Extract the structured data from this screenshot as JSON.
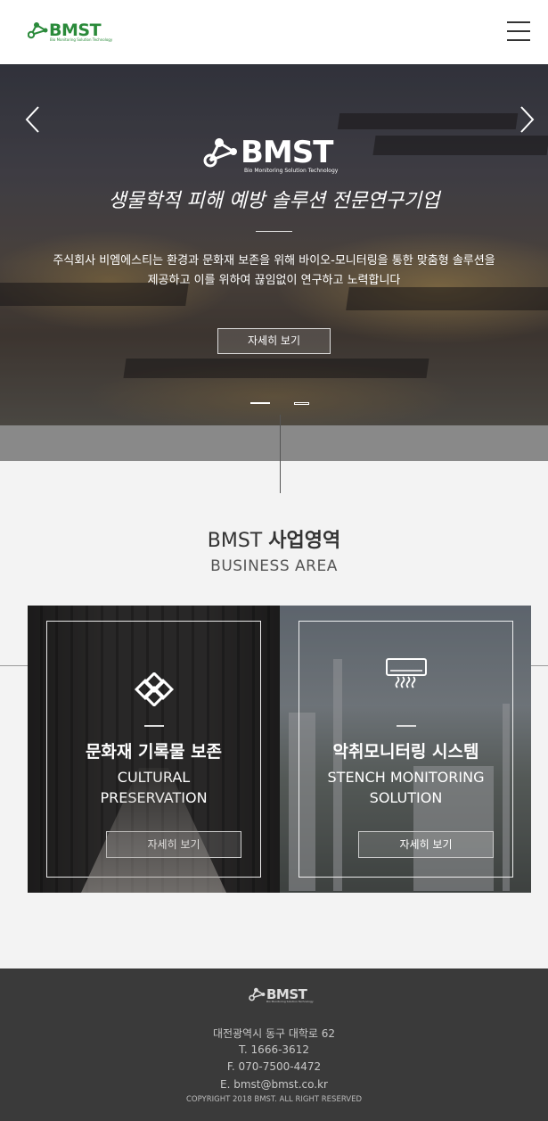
{
  "header": {
    "logo_text": "BMST",
    "logo_sub": "Bio Monitoring Solution Technology",
    "brand_color": "#2a8a3a",
    "menu_icon": "hamburger-menu-icon"
  },
  "hero": {
    "logo_text": "BMST",
    "logo_sub": "Bio Monitoring Solution Technology",
    "title": "생물학적 피해 예방 솔루션 전문연구기업",
    "desc_line1": "주식회사 비엠에스티는 환경과 문화재 보존을 위해 바이오-모니터링을 통한 맞춤형 솔루션을",
    "desc_line2": "제공하고 이를 위하여 끊임없이 연구하고 노력합니다",
    "button_label": "자세히 보기",
    "prev_icon": "chevron-left-icon",
    "next_icon": "chevron-right-icon",
    "slide_count": 2,
    "active_slide": 1
  },
  "business": {
    "title_prefix": "BMST",
    "title_main": "사업영역",
    "subtitle": "BUSINESS AREA",
    "cards": [
      {
        "icon": "knot-icon",
        "title": "문화재 기록물 보존",
        "en_line1": "CULTURAL",
        "en_line2": "PRESERVATION",
        "button_label": "자세히 보기"
      },
      {
        "icon": "odor-sensor-icon",
        "title": "악취모니터링 시스템",
        "en_line1": "STENCH MONITORING",
        "en_line2": "SOLUTION",
        "button_label": "자세히 보기"
      }
    ]
  },
  "footer": {
    "logo_text": "BMST",
    "logo_sub": "Bio Monitoring Solution Technology",
    "address": "대전광역시 동구 대학로 62",
    "tel": "T.  1666-3612",
    "fax": "F.  070-7500-4472",
    "email": "E.  bmst@bmst.co.kr",
    "copyright": "COPYRIGHT 2018 BMST. ALL RIGHT RESERVED"
  }
}
